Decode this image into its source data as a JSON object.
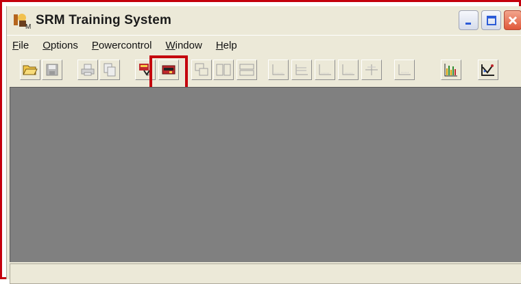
{
  "window": {
    "title": "SRM Training System"
  },
  "menu": [
    {
      "underline": "F",
      "rest": "ile"
    },
    {
      "underline": "O",
      "rest": "ptions"
    },
    {
      "underline": "P",
      "rest": "owercontrol"
    },
    {
      "underline": "W",
      "rest": "indow"
    },
    {
      "underline": "H",
      "rest": "elp"
    }
  ],
  "toolbar": {
    "buttons": [
      {
        "icon": "open-folder-icon",
        "enabled": true
      },
      {
        "icon": "save-icon",
        "enabled": false
      },
      {
        "icon": "print-icon",
        "enabled": false
      },
      {
        "icon": "copy-icon",
        "enabled": false
      },
      {
        "icon": "download-icon",
        "enabled": true
      },
      {
        "icon": "powercontrol-icon",
        "enabled": true,
        "highlighted": true
      },
      {
        "icon": "cascade-icon",
        "enabled": false
      },
      {
        "icon": "tile-vertical-icon",
        "enabled": false
      },
      {
        "icon": "tile-horizontal-icon",
        "enabled": false
      },
      {
        "icon": "chart-1-icon",
        "enabled": false
      },
      {
        "icon": "chart-2-icon",
        "enabled": false
      },
      {
        "icon": "chart-3-icon",
        "enabled": false
      },
      {
        "icon": "chart-4-icon",
        "enabled": false
      },
      {
        "icon": "chart-5-icon",
        "enabled": false
      },
      {
        "icon": "chart-6-icon",
        "enabled": false
      },
      {
        "icon": "bar-chart-icon",
        "enabled": true
      },
      {
        "icon": "scatter-icon",
        "enabled": true
      }
    ]
  },
  "statusbar": {
    "text": ""
  },
  "colors": {
    "highlight": "#c4000c",
    "client_background": "#808080",
    "chrome": "#ECE9D8"
  }
}
